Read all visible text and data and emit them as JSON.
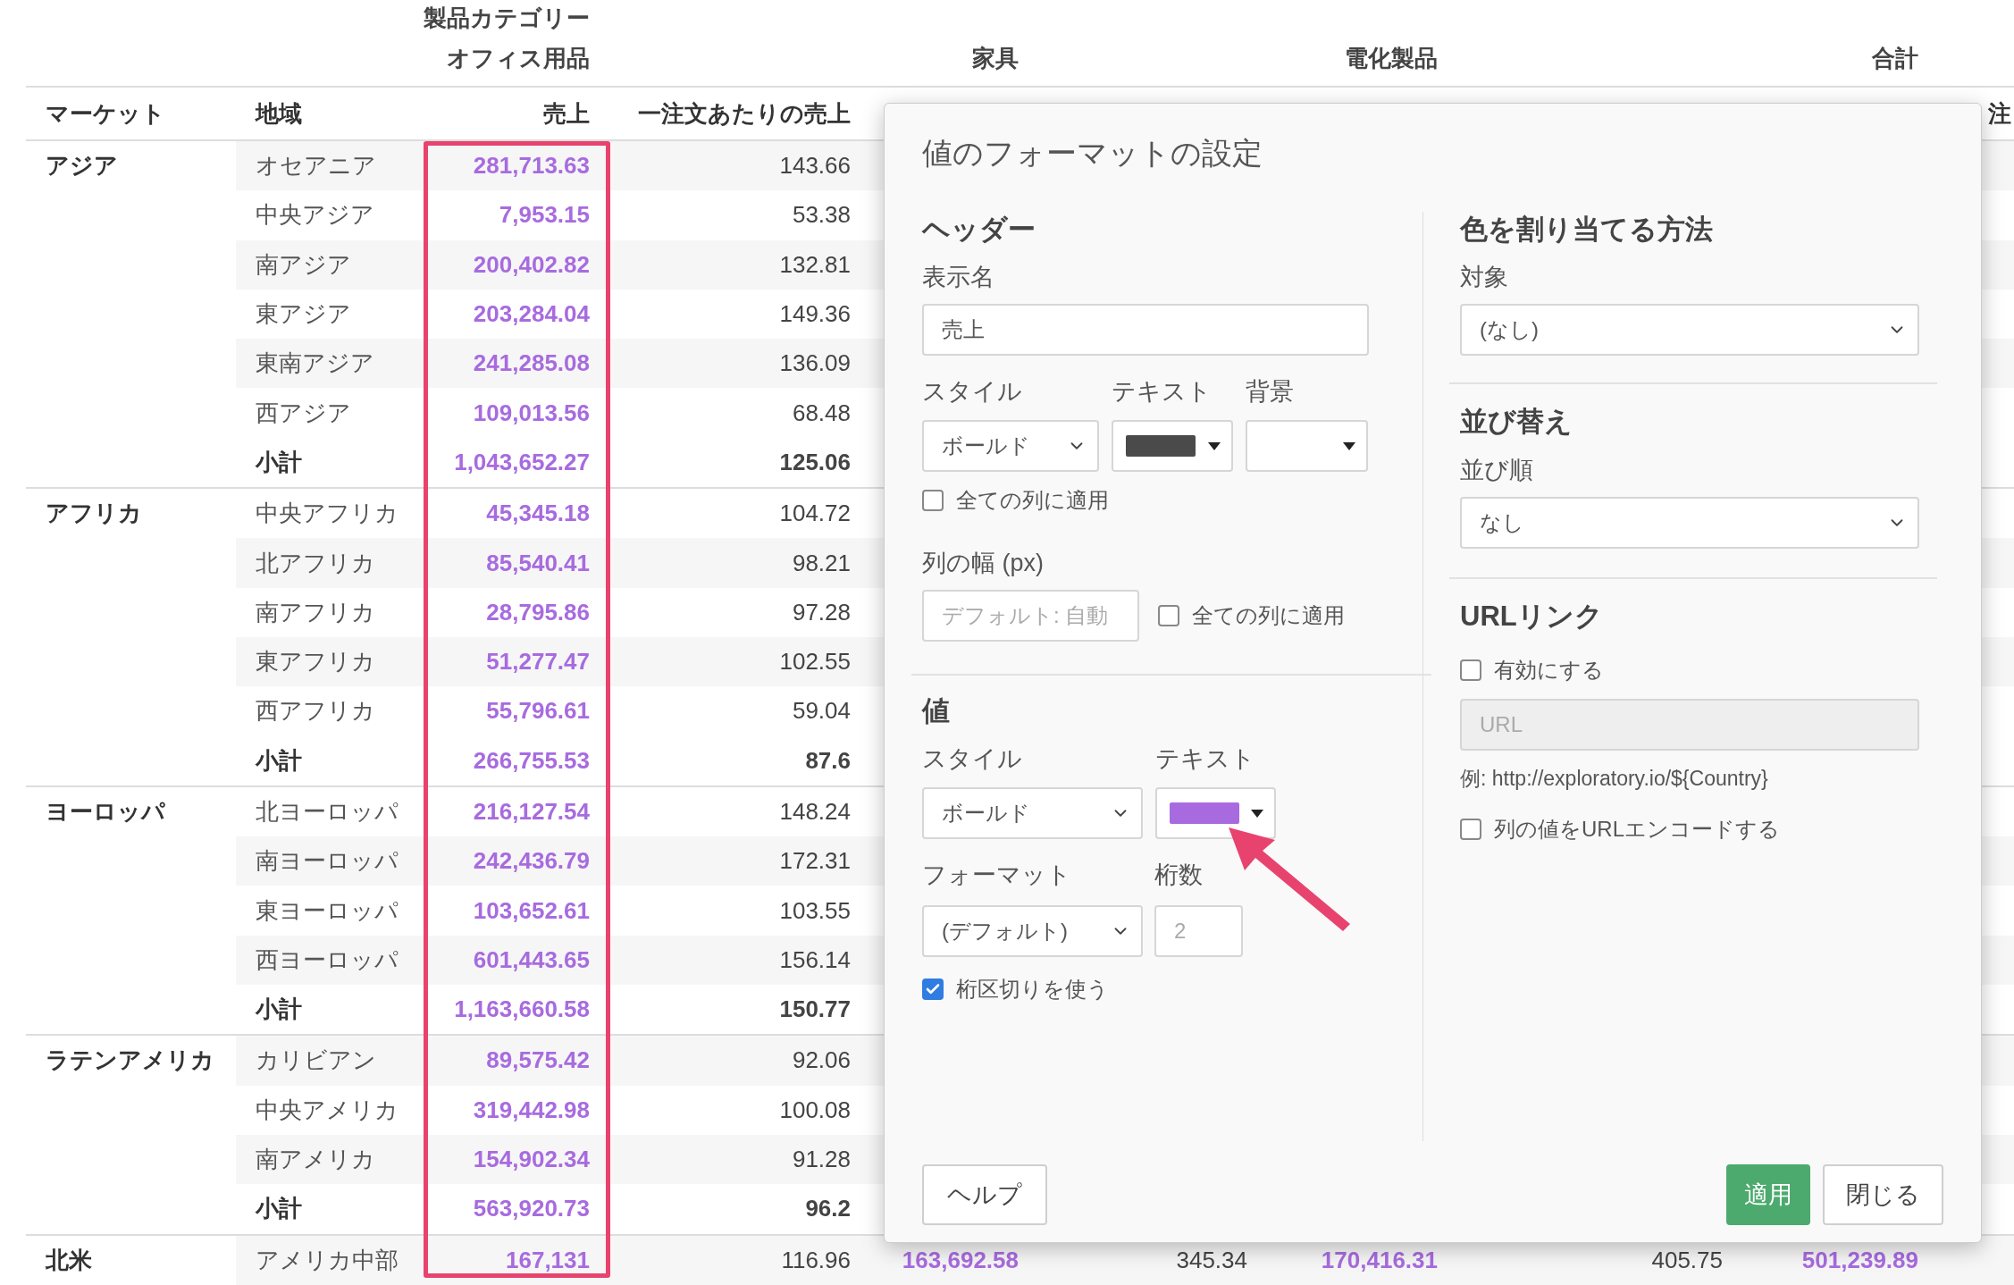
{
  "table": {
    "category_header": "製品カテゴリー",
    "categories": [
      "オフィス用品",
      "家具",
      "電化製品",
      "合計"
    ],
    "columns": [
      "マーケット",
      "地域",
      "売上",
      "一注文あたりの売上"
    ],
    "column_cut": "注",
    "groups": [
      {
        "market": "アジア",
        "rows": [
          {
            "region": "オセアニア",
            "values": [
              "281,713.63",
              "143.66"
            ]
          },
          {
            "region": "中央アジア",
            "values": [
              "7,953.15",
              "53.38"
            ]
          },
          {
            "region": "南アジア",
            "values": [
              "200,402.82",
              "132.81"
            ]
          },
          {
            "region": "東アジア",
            "values": [
              "203,284.04",
              "149.36"
            ]
          },
          {
            "region": "東南アジア",
            "values": [
              "241,285.08",
              "136.09"
            ]
          },
          {
            "region": "西アジア",
            "values": [
              "109,013.56",
              "68.48"
            ]
          },
          {
            "region": "小計",
            "subtotal": true,
            "values": [
              "1,043,652.27",
              "125.06"
            ]
          }
        ]
      },
      {
        "market": "アフリカ",
        "rows": [
          {
            "region": "中央アフリカ",
            "values": [
              "45,345.18",
              "104.72"
            ]
          },
          {
            "region": "北アフリカ",
            "values": [
              "85,540.41",
              "98.21"
            ]
          },
          {
            "region": "南アフリカ",
            "values": [
              "28,795.86",
              "97.28"
            ]
          },
          {
            "region": "東アフリカ",
            "values": [
              "51,277.47",
              "102.55"
            ]
          },
          {
            "region": "西アフリカ",
            "values": [
              "55,796.61",
              "59.04"
            ]
          },
          {
            "region": "小計",
            "subtotal": true,
            "values": [
              "266,755.53",
              "87.6"
            ]
          }
        ]
      },
      {
        "market": "ヨーロッパ",
        "rows": [
          {
            "region": "北ヨーロッパ",
            "values": [
              "216,127.54",
              "148.24"
            ]
          },
          {
            "region": "南ヨーロッパ",
            "values": [
              "242,436.79",
              "172.31"
            ]
          },
          {
            "region": "東ヨーロッパ",
            "values": [
              "103,652.61",
              "103.55"
            ]
          },
          {
            "region": "西ヨーロッパ",
            "values": [
              "601,443.65",
              "156.14"
            ]
          },
          {
            "region": "小計",
            "subtotal": true,
            "values": [
              "1,163,660.58",
              "150.77"
            ]
          }
        ]
      },
      {
        "market": "ラテンアメリカ",
        "rows": [
          {
            "region": "カリビアン",
            "values": [
              "89,575.42",
              "92.06"
            ]
          },
          {
            "region": "中央アメリカ",
            "values": [
              "319,442.98",
              "100.08"
            ]
          },
          {
            "region": "南アメリカ",
            "values": [
              "154,902.34",
              "91.28"
            ]
          },
          {
            "region": "小計",
            "subtotal": true,
            "values": [
              "563,920.73",
              "96.2"
            ]
          }
        ]
      },
      {
        "market": "北米",
        "rows": [
          {
            "region": "アメリカ中部",
            "values": [
              "167,131",
              "116.96",
              "163,692.58",
              "345.34",
              "170,416.31",
              "405.75",
              "501,239.89"
            ]
          }
        ]
      }
    ]
  },
  "dialog": {
    "title": "値のフォーマットの設定",
    "header_section": {
      "heading": "ヘッダー",
      "display_name_label": "表示名",
      "display_name": "売上",
      "style_label": "スタイル",
      "style": "ボールド",
      "text_label": "テキスト",
      "color": "#4a4a4a",
      "background_label": "背景",
      "apply_all": {
        "label": "全ての列に適用",
        "checked": false
      },
      "width_label": "列の幅 (px)",
      "width_placeholder": "デフォルト: 自動",
      "width_apply_all": {
        "label": "全ての列に適用",
        "checked": false
      }
    },
    "value_section": {
      "heading": "値",
      "style_label": "スタイル",
      "style": "ボールド",
      "text_label": "テキスト",
      "color": "#a86bdf",
      "format_label": "フォーマット",
      "format": "(デフォルト)",
      "digits_label": "桁数",
      "digits_placeholder": "2",
      "separator": {
        "label": "桁区切りを使う",
        "checked": true
      }
    },
    "color_section": {
      "heading": "色を割り当てる方法",
      "target_label": "対象",
      "target": "(なし)"
    },
    "sort_section": {
      "heading": "並び替え",
      "order_label": "並び順",
      "order": "なし"
    },
    "url_section": {
      "heading": "URLリンク",
      "enable": {
        "label": "有効にする",
        "checked": false
      },
      "url_placeholder": "URL",
      "example": "例: http://exploratory.io/${Country}",
      "encode": {
        "label": "列の値をURLエンコードする",
        "checked": false
      }
    },
    "buttons": {
      "help": "ヘルプ",
      "apply": "適用",
      "close": "閉じる"
    }
  }
}
